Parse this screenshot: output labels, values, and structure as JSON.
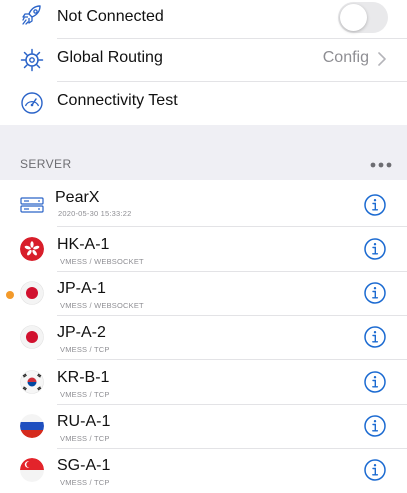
{
  "colors": {
    "accent": "#1b6ad1",
    "icon_blue": "#2a63c8",
    "active_dot": "#f39a2a",
    "secondary_text": "#8e8e93"
  },
  "settings": {
    "connection": {
      "label": "Not Connected",
      "icon": "rocket-icon",
      "toggle_on": false
    },
    "routing": {
      "label": "Global Routing",
      "icon": "helm-icon",
      "value": "Config"
    },
    "test": {
      "label": "Connectivity Test",
      "icon": "speedometer-icon"
    }
  },
  "server_section": {
    "header": "SERVER",
    "more_icon": "ellipsis-icon"
  },
  "servers": [
    {
      "name": "PearX",
      "sub": "2020-05-30 15:33:22",
      "icon": "server-rack-icon",
      "active": false
    },
    {
      "name": "HK-A-1",
      "sub": "VMESS / WEBSOCKET",
      "icon": "hong-kong-flag-icon",
      "active": false
    },
    {
      "name": "JP-A-1",
      "sub": "VMESS / WEBSOCKET",
      "icon": "japan-flag-icon",
      "active": true
    },
    {
      "name": "JP-A-2",
      "sub": "VMESS / TCP",
      "icon": "japan-flag-icon",
      "active": false
    },
    {
      "name": "KR-B-1",
      "sub": "VMESS / TCP",
      "icon": "south-korea-flag-icon",
      "active": false
    },
    {
      "name": "RU-A-1",
      "sub": "VMESS / TCP",
      "icon": "russia-flag-icon",
      "active": false
    },
    {
      "name": "SG-A-1",
      "sub": "VMESS / TCP",
      "icon": "singapore-flag-icon",
      "active": false
    }
  ]
}
